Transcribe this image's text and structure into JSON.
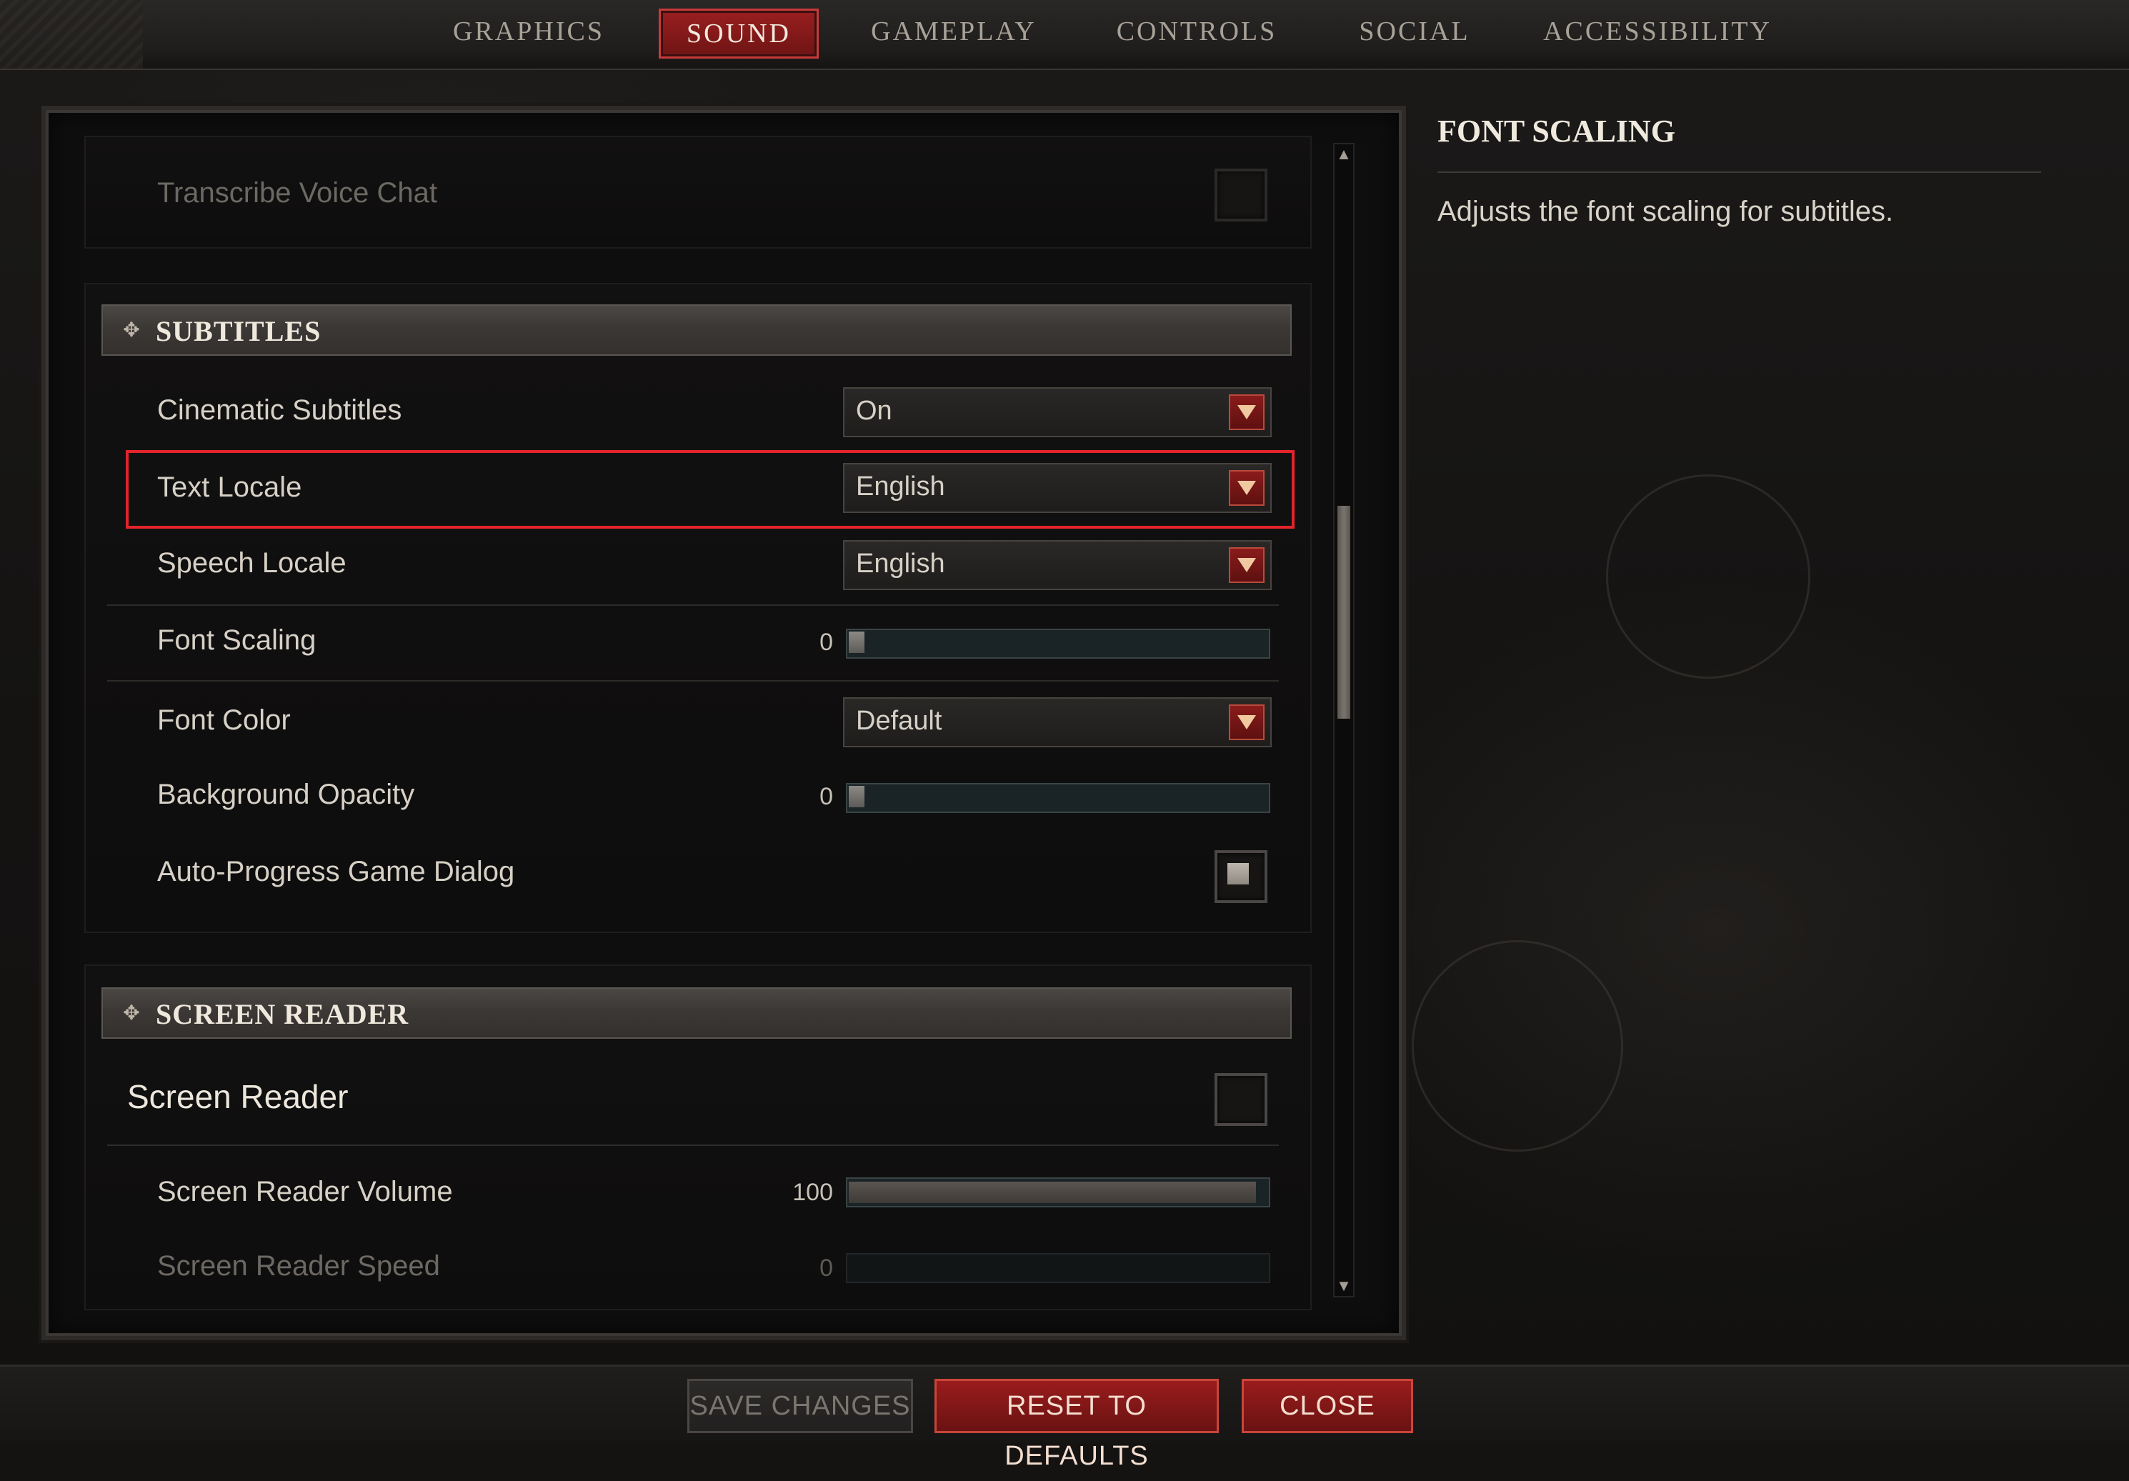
{
  "tabs": [
    {
      "label": "GRAPHICS"
    },
    {
      "label": "SOUND"
    },
    {
      "label": "GAMEPLAY"
    },
    {
      "label": "CONTROLS"
    },
    {
      "label": "SOCIAL"
    },
    {
      "label": "ACCESSIBILITY"
    }
  ],
  "active_tab": "SOUND",
  "top_section": {
    "transcribe_voice_chat": {
      "label": "Transcribe Voice Chat",
      "checked": false
    }
  },
  "subtitles": {
    "header": "SUBTITLES",
    "cinematic_subtitles": {
      "label": "Cinematic Subtitles",
      "value": "On"
    },
    "text_locale": {
      "label": "Text Locale",
      "value": "English"
    },
    "speech_locale": {
      "label": "Speech Locale",
      "value": "English"
    },
    "font_scaling": {
      "label": "Font Scaling",
      "value": "0"
    },
    "font_color": {
      "label": "Font Color",
      "value": "Default"
    },
    "background_opacity": {
      "label": "Background Opacity",
      "value": "0"
    },
    "auto_progress": {
      "label": "Auto-Progress Game Dialog",
      "checked": true
    }
  },
  "screen_reader": {
    "header": "SCREEN READER",
    "toggle": {
      "label": "Screen Reader",
      "checked": false
    },
    "volume": {
      "label": "Screen Reader Volume",
      "value": "100",
      "fraction": 1.0
    },
    "speed": {
      "label": "Screen Reader Speed",
      "value": "0",
      "fraction": 0.0
    }
  },
  "info_panel": {
    "title": "FONT SCALING",
    "description": "Adjusts the font scaling for subtitles."
  },
  "buttons": {
    "save": "SAVE CHANGES",
    "reset": "RESET TO DEFAULTS",
    "close": "CLOSE"
  },
  "icons": {
    "section_marker": "diamond-cluster-icon",
    "dropdown_arrow": "triangle-down-icon",
    "scroll_up": "scroll-up-arrow-icon",
    "scroll_down": "scroll-down-arrow-icon"
  },
  "colors": {
    "accent_red": "#9a1c1c",
    "highlight_outline": "#e3242b"
  }
}
